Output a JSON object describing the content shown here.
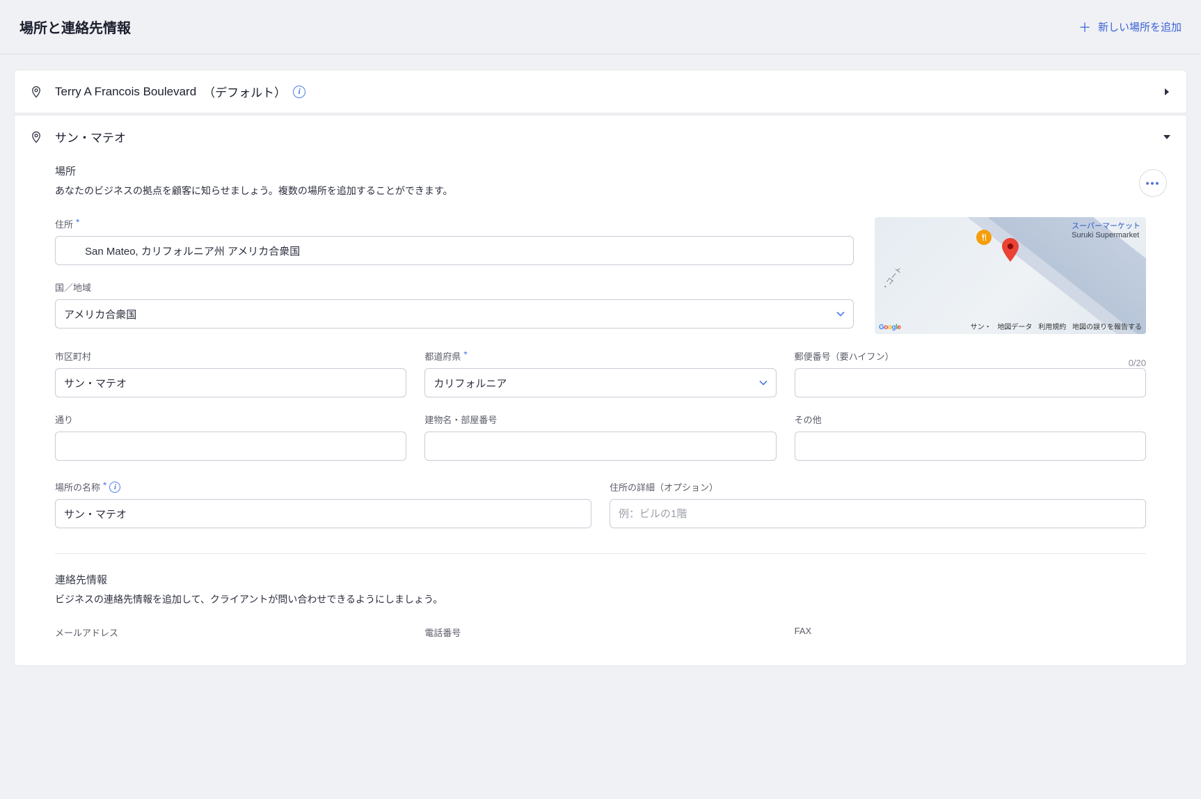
{
  "header": {
    "title": "場所と連絡先情報",
    "add_label": "新しい場所を追加"
  },
  "locations": [
    {
      "name": "Terry A Francois Boulevard",
      "default_suffix": "（デフォルト）"
    },
    {
      "name": "サン・マテオ"
    }
  ],
  "section_location": {
    "heading": "場所",
    "description": "あなたのビジネスの拠点を顧客に知らせましょう。複数の場所を追加することができます。"
  },
  "form": {
    "address_label": "住所",
    "address_value": "San Mateo, カリフォルニア州 アメリカ合衆国",
    "country_label": "国／地域",
    "country_value": "アメリカ合衆国",
    "city_label": "市区町村",
    "city_value": "サン・マテオ",
    "state_label": "都道府県",
    "state_value": "カリフォルニア",
    "postal_label": "郵便番号（要ハイフン）",
    "postal_counter": "0/20",
    "postal_value": "",
    "street_label": "通り",
    "street_value": "",
    "building_label": "建物名・部屋番号",
    "building_value": "",
    "other_label": "その他",
    "other_value": "",
    "location_name_label": "場所の名称",
    "location_name_value": "サン・マテオ",
    "address_detail_label": "住所の詳細（オプション）",
    "address_detail_placeholder": "例：ビルの1階"
  },
  "map": {
    "supermarket_jp": "スーパーマーケット",
    "supermarket_en": "Suruki Supermarket",
    "court_label": "・コート",
    "san_label": "サン・",
    "map_data": "地図データ",
    "terms": "利用規約",
    "report": "地図の誤りを報告する"
  },
  "section_contact": {
    "heading": "連絡先情報",
    "description": "ビジネスの連絡先情報を追加して、クライアントが問い合わせできるようにしましょう。",
    "email_label": "メールアドレス",
    "phone_label": "電話番号",
    "fax_label": "FAX"
  }
}
